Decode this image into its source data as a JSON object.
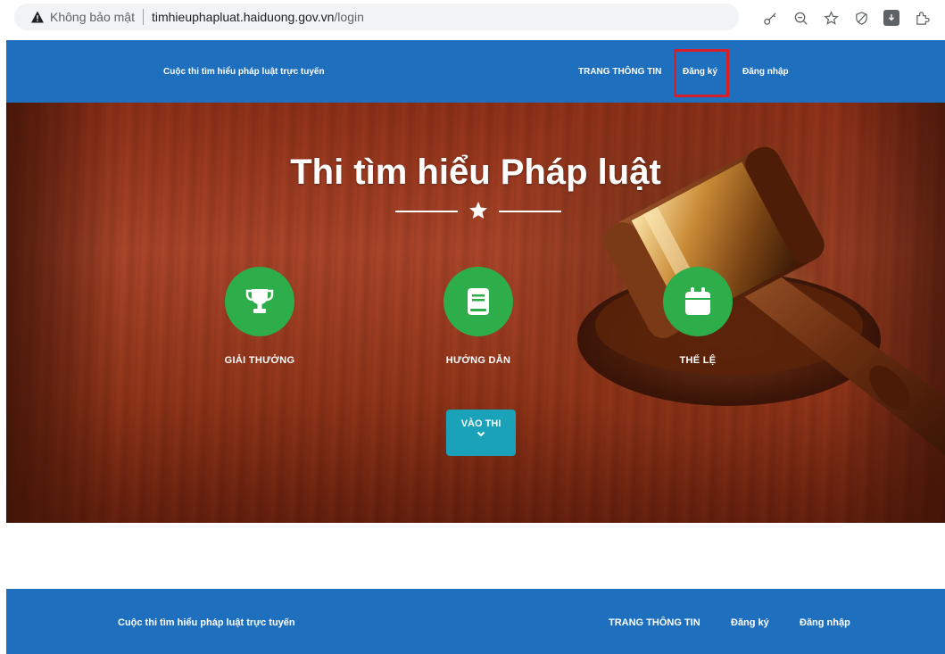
{
  "browser": {
    "security_status": "Không bảo mật",
    "url_host": "timhieuphapluat.haiduong.gov.vn",
    "url_path": "/login",
    "icons": [
      "warning-icon",
      "key-icon",
      "zoom-out-icon",
      "star-bookmark-icon",
      "shield-icon",
      "download-icon",
      "extensions-icon"
    ]
  },
  "header": {
    "site_title": "Cuộc thi tìm hiểu pháp luật trực tuyến",
    "nav": {
      "info": "TRANG THÔNG TIN",
      "register": "Đăng ký",
      "login": "Đăng nhập"
    },
    "highlight_color": "#d61f2a"
  },
  "hero": {
    "title": "Thi tìm hiểu Pháp luật",
    "features": [
      {
        "label": "GIẢI THƯỞNG",
        "icon": "trophy-icon"
      },
      {
        "label": "HƯỚNG DẪN",
        "icon": "book-icon"
      },
      {
        "label": "THỂ LỆ",
        "icon": "calendar-icon"
      }
    ],
    "enter_button": "VÀO THI"
  },
  "footer_header": {
    "site_title": "Cuộc thi tìm hiểu pháp luật trực tuyến",
    "nav": {
      "info": "TRANG THÔNG TIN",
      "register": "Đăng ký",
      "login": "Đăng nhập"
    }
  },
  "colors": {
    "header_blue": "#1f6fbf",
    "feature_green": "#2eae4a",
    "button_teal": "#1aa3b8"
  }
}
